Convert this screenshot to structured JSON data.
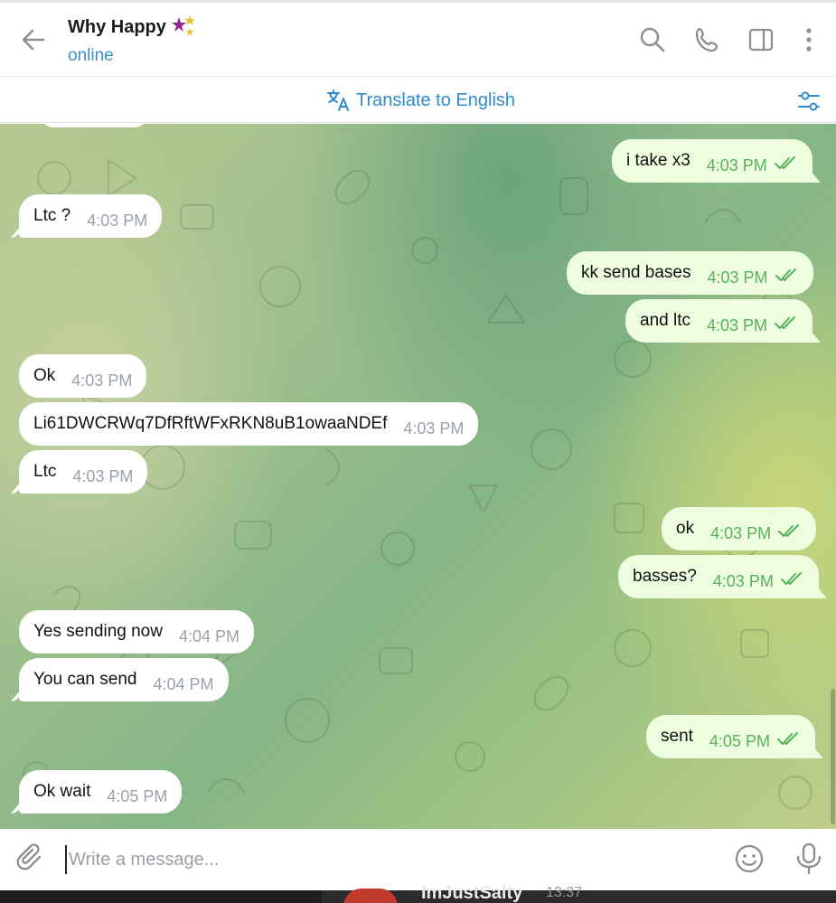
{
  "header": {
    "title": "Why Happy",
    "status": "online"
  },
  "translate": {
    "label": "Translate to English"
  },
  "messages": [
    {
      "dir": "out",
      "text": "i take x3",
      "time": "4:03 PM"
    },
    {
      "dir": "in",
      "text": "Ltc ?",
      "time": "4:03 PM"
    },
    {
      "dir": "out",
      "text": "kk send bases",
      "time": "4:03 PM"
    },
    {
      "dir": "out",
      "text": "and ltc",
      "time": "4:03 PM"
    },
    {
      "dir": "in",
      "text": "Ok",
      "time": "4:03 PM"
    },
    {
      "dir": "in",
      "text": "Li61DWCRWq7DfRftWFxRKN8uB1owaaNDEf",
      "time": "4:03 PM"
    },
    {
      "dir": "in",
      "text": "Ltc",
      "time": "4:03 PM"
    },
    {
      "dir": "out",
      "text": "ok",
      "time": "4:03 PM"
    },
    {
      "dir": "out",
      "text": "basses?",
      "time": "4:03 PM"
    },
    {
      "dir": "in",
      "text": "Yes sending now",
      "time": "4:04 PM"
    },
    {
      "dir": "in",
      "text": "You can send",
      "time": "4:04 PM"
    },
    {
      "dir": "out",
      "text": "sent",
      "time": "4:05 PM"
    },
    {
      "dir": "in",
      "text": "Ok wait",
      "time": "4:05 PM"
    }
  ],
  "composer": {
    "placeholder": "Write a message..."
  },
  "taskbar": {
    "app_text": "ImJustSalty",
    "time": "13:37"
  },
  "colors": {
    "accent": "#3a8fd0",
    "incoming_bubble": "#ffffff",
    "outgoing_bubble": "#eefcdf",
    "outgoing_time": "#58b15a"
  }
}
